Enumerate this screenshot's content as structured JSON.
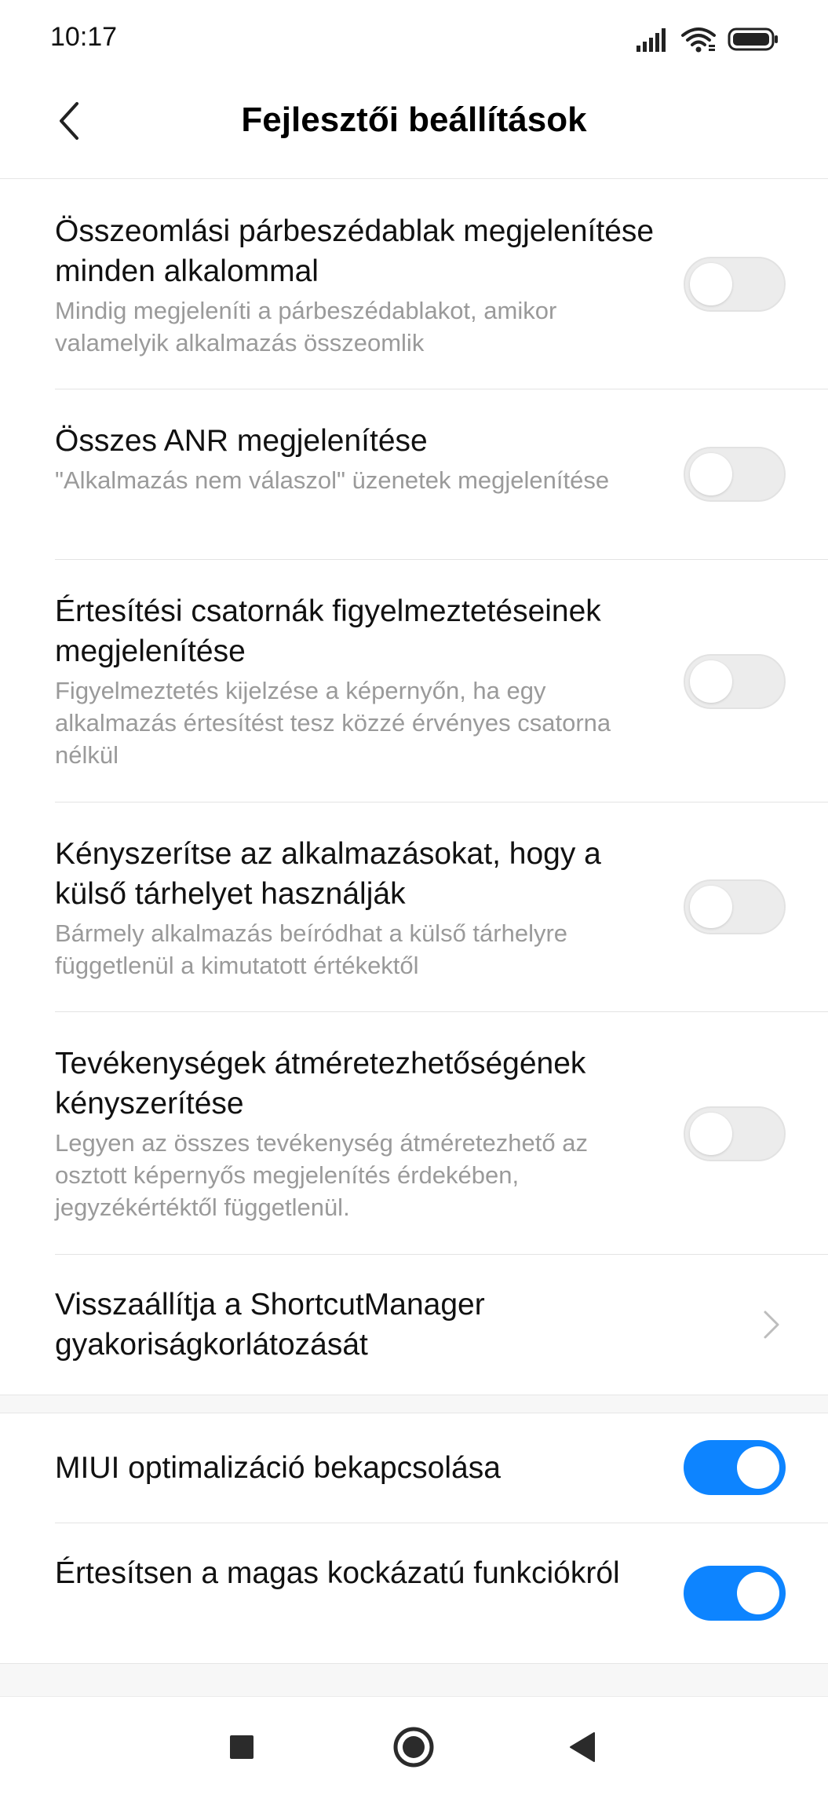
{
  "status": {
    "time": "10:17"
  },
  "header": {
    "title": "Fejlesztői beállítások"
  },
  "settings": [
    {
      "title": "Összeomlási párbeszédablak megjelenítése minden alkalommal",
      "subtitle": "Mindig megjeleníti a párbeszédablakot, amikor valamelyik alkalmazás összeomlik",
      "state": "off"
    },
    {
      "title": "Összes ANR megjelenítése",
      "subtitle": "\"Alkalmazás nem válaszol\" üzenetek megjelenítése",
      "state": "off"
    },
    {
      "title": "Értesítési csatornák figyelmeztetéseinek megjelenítése",
      "subtitle": "Figyelmeztetés kijelzése a képernyőn, ha egy alkalmazás értesítést tesz közzé érvényes csatorna nélkül",
      "state": "off"
    },
    {
      "title": "Kényszerítse az alkalmazásokat, hogy a külső tárhelyet használják",
      "subtitle": "Bármely alkalmazás beíródhat a külső tárhelyre függetlenül a kimutatott értékektől",
      "state": "off"
    },
    {
      "title": "Tevékenységek átméretezhetőségének kényszerítése",
      "subtitle": "Legyen az összes tevékenység átméretezhető az osztott képernyős megjelenítés érdekében, jegyzékértéktől függetlenül.",
      "state": "off"
    },
    {
      "title": "Visszaállítja a ShortcutManager gyakoriságkorlátozását",
      "type": "link"
    }
  ],
  "miui_settings": [
    {
      "title": "MIUI optimalizáció bekapcsolása",
      "state": "on"
    },
    {
      "title": "Értesítsen a magas kockázatú funkciókról",
      "state": "on"
    }
  ],
  "colors": {
    "accent": "#0d84ff",
    "toggle_off": "#ececec",
    "subtitle": "#9a9a9a"
  },
  "icons": {
    "status": [
      "signal-icon",
      "wifi-icon",
      "battery-icon"
    ],
    "nav": [
      "recents-square-icon",
      "home-circle-icon",
      "back-triangle-icon"
    ]
  }
}
